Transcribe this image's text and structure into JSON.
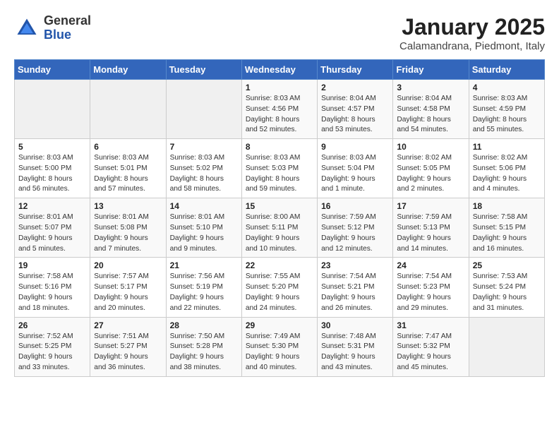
{
  "logo": {
    "general": "General",
    "blue": "Blue"
  },
  "title": "January 2025",
  "subtitle": "Calamandrana, Piedmont, Italy",
  "headers": [
    "Sunday",
    "Monday",
    "Tuesday",
    "Wednesday",
    "Thursday",
    "Friday",
    "Saturday"
  ],
  "weeks": [
    [
      {
        "num": "",
        "info": "",
        "empty": true
      },
      {
        "num": "",
        "info": "",
        "empty": true
      },
      {
        "num": "",
        "info": "",
        "empty": true
      },
      {
        "num": "1",
        "info": "Sunrise: 8:03 AM\nSunset: 4:56 PM\nDaylight: 8 hours\nand 52 minutes."
      },
      {
        "num": "2",
        "info": "Sunrise: 8:04 AM\nSunset: 4:57 PM\nDaylight: 8 hours\nand 53 minutes."
      },
      {
        "num": "3",
        "info": "Sunrise: 8:04 AM\nSunset: 4:58 PM\nDaylight: 8 hours\nand 54 minutes."
      },
      {
        "num": "4",
        "info": "Sunrise: 8:03 AM\nSunset: 4:59 PM\nDaylight: 8 hours\nand 55 minutes."
      }
    ],
    [
      {
        "num": "5",
        "info": "Sunrise: 8:03 AM\nSunset: 5:00 PM\nDaylight: 8 hours\nand 56 minutes."
      },
      {
        "num": "6",
        "info": "Sunrise: 8:03 AM\nSunset: 5:01 PM\nDaylight: 8 hours\nand 57 minutes."
      },
      {
        "num": "7",
        "info": "Sunrise: 8:03 AM\nSunset: 5:02 PM\nDaylight: 8 hours\nand 58 minutes."
      },
      {
        "num": "8",
        "info": "Sunrise: 8:03 AM\nSunset: 5:03 PM\nDaylight: 8 hours\nand 59 minutes."
      },
      {
        "num": "9",
        "info": "Sunrise: 8:03 AM\nSunset: 5:04 PM\nDaylight: 9 hours\nand 1 minute."
      },
      {
        "num": "10",
        "info": "Sunrise: 8:02 AM\nSunset: 5:05 PM\nDaylight: 9 hours\nand 2 minutes."
      },
      {
        "num": "11",
        "info": "Sunrise: 8:02 AM\nSunset: 5:06 PM\nDaylight: 9 hours\nand 4 minutes."
      }
    ],
    [
      {
        "num": "12",
        "info": "Sunrise: 8:01 AM\nSunset: 5:07 PM\nDaylight: 9 hours\nand 5 minutes."
      },
      {
        "num": "13",
        "info": "Sunrise: 8:01 AM\nSunset: 5:08 PM\nDaylight: 9 hours\nand 7 minutes."
      },
      {
        "num": "14",
        "info": "Sunrise: 8:01 AM\nSunset: 5:10 PM\nDaylight: 9 hours\nand 9 minutes."
      },
      {
        "num": "15",
        "info": "Sunrise: 8:00 AM\nSunset: 5:11 PM\nDaylight: 9 hours\nand 10 minutes."
      },
      {
        "num": "16",
        "info": "Sunrise: 7:59 AM\nSunset: 5:12 PM\nDaylight: 9 hours\nand 12 minutes."
      },
      {
        "num": "17",
        "info": "Sunrise: 7:59 AM\nSunset: 5:13 PM\nDaylight: 9 hours\nand 14 minutes."
      },
      {
        "num": "18",
        "info": "Sunrise: 7:58 AM\nSunset: 5:15 PM\nDaylight: 9 hours\nand 16 minutes."
      }
    ],
    [
      {
        "num": "19",
        "info": "Sunrise: 7:58 AM\nSunset: 5:16 PM\nDaylight: 9 hours\nand 18 minutes."
      },
      {
        "num": "20",
        "info": "Sunrise: 7:57 AM\nSunset: 5:17 PM\nDaylight: 9 hours\nand 20 minutes."
      },
      {
        "num": "21",
        "info": "Sunrise: 7:56 AM\nSunset: 5:19 PM\nDaylight: 9 hours\nand 22 minutes."
      },
      {
        "num": "22",
        "info": "Sunrise: 7:55 AM\nSunset: 5:20 PM\nDaylight: 9 hours\nand 24 minutes."
      },
      {
        "num": "23",
        "info": "Sunrise: 7:54 AM\nSunset: 5:21 PM\nDaylight: 9 hours\nand 26 minutes."
      },
      {
        "num": "24",
        "info": "Sunrise: 7:54 AM\nSunset: 5:23 PM\nDaylight: 9 hours\nand 29 minutes."
      },
      {
        "num": "25",
        "info": "Sunrise: 7:53 AM\nSunset: 5:24 PM\nDaylight: 9 hours\nand 31 minutes."
      }
    ],
    [
      {
        "num": "26",
        "info": "Sunrise: 7:52 AM\nSunset: 5:25 PM\nDaylight: 9 hours\nand 33 minutes."
      },
      {
        "num": "27",
        "info": "Sunrise: 7:51 AM\nSunset: 5:27 PM\nDaylight: 9 hours\nand 36 minutes."
      },
      {
        "num": "28",
        "info": "Sunrise: 7:50 AM\nSunset: 5:28 PM\nDaylight: 9 hours\nand 38 minutes."
      },
      {
        "num": "29",
        "info": "Sunrise: 7:49 AM\nSunset: 5:30 PM\nDaylight: 9 hours\nand 40 minutes."
      },
      {
        "num": "30",
        "info": "Sunrise: 7:48 AM\nSunset: 5:31 PM\nDaylight: 9 hours\nand 43 minutes."
      },
      {
        "num": "31",
        "info": "Sunrise: 7:47 AM\nSunset: 5:32 PM\nDaylight: 9 hours\nand 45 minutes."
      },
      {
        "num": "",
        "info": "",
        "empty": true
      }
    ]
  ]
}
